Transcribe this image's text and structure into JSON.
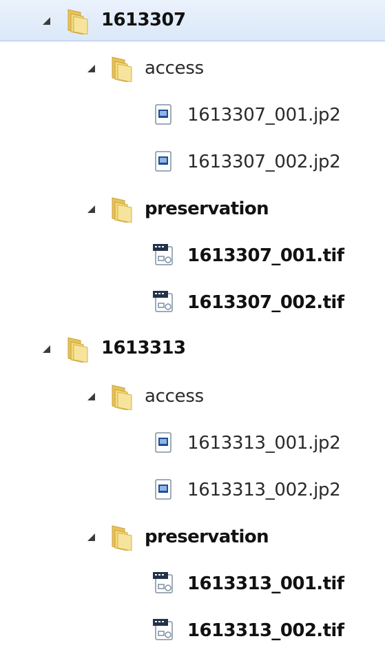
{
  "accent": {
    "selected_bg": "#dbe8f8",
    "selected_border": "#a8c5ea",
    "folder": "#e8c259"
  },
  "tree": [
    {
      "name": "1613307",
      "selected": true,
      "children": [
        {
          "name": "access",
          "files": [
            "1613307_001.jp2",
            "1613307_002.jp2"
          ]
        },
        {
          "name": "preservation",
          "files": [
            "1613307_001.tif",
            "1613307_002.tif"
          ]
        }
      ]
    },
    {
      "name": "1613313",
      "selected": false,
      "children": [
        {
          "name": "access",
          "files": [
            "1613313_001.jp2",
            "1613313_002.jp2"
          ]
        },
        {
          "name": "preservation",
          "files": [
            "1613313_001.tif",
            "1613313_002.tif"
          ]
        }
      ]
    }
  ],
  "icons": {
    "expand": "expanded-arrow-icon",
    "folder": "folder-icon",
    "jp2": "jp2-file-icon",
    "tif": "tif-file-icon"
  }
}
